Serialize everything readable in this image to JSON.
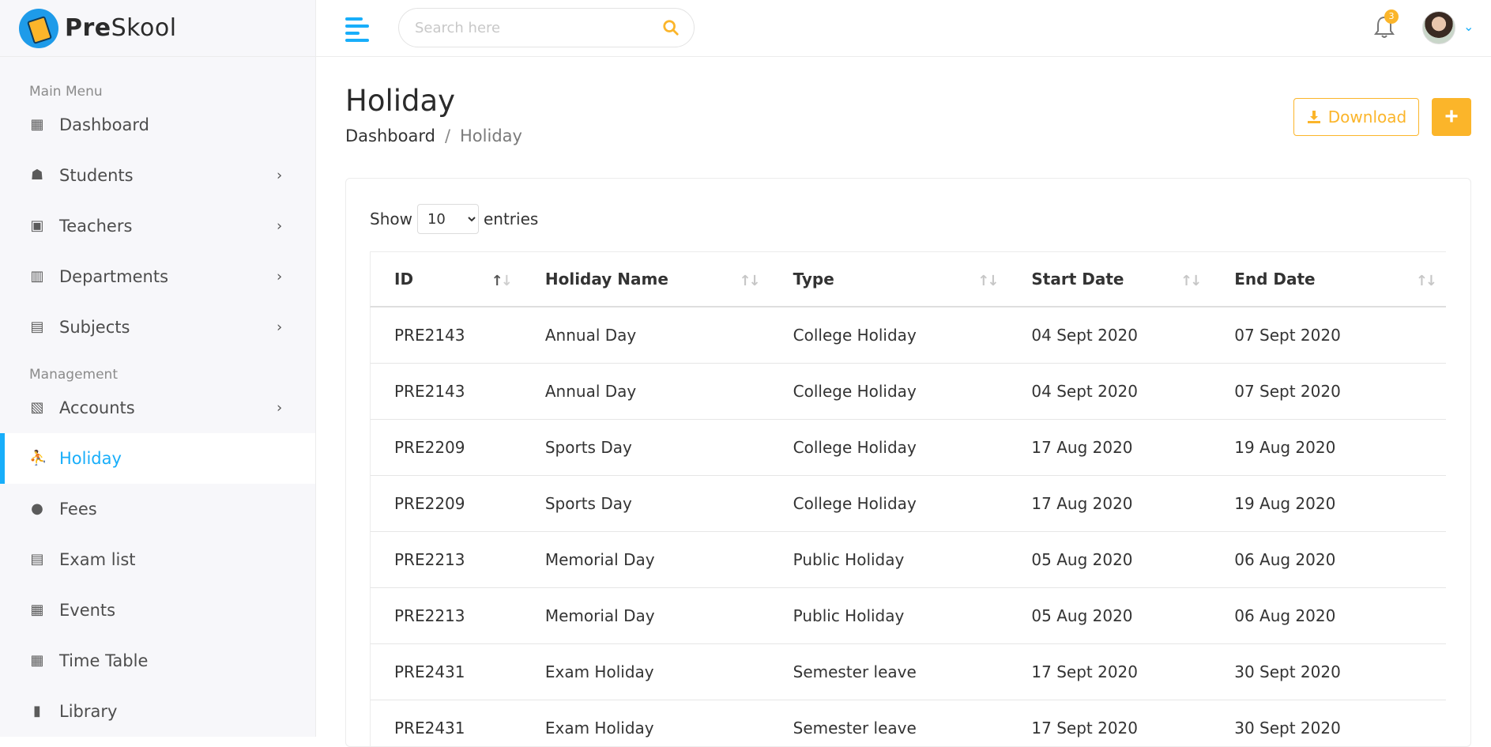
{
  "brand": {
    "name_bold": "Pre",
    "name_rest": "Skool"
  },
  "sidebar": {
    "section_main": "Main Menu",
    "section_management": "Management",
    "main_items": [
      {
        "label": "Dashboard",
        "icon": "dashboard-icon",
        "has_children": false
      },
      {
        "label": "Students",
        "icon": "student-icon",
        "has_children": true
      },
      {
        "label": "Teachers",
        "icon": "teacher-icon",
        "has_children": true
      },
      {
        "label": "Departments",
        "icon": "building-icon",
        "has_children": true
      },
      {
        "label": "Subjects",
        "icon": "book-reader-icon",
        "has_children": true
      }
    ],
    "management_items": [
      {
        "label": "Accounts",
        "icon": "invoice-icon",
        "has_children": true
      },
      {
        "label": "Holiday",
        "icon": "holiday-icon",
        "has_children": false,
        "active": true
      },
      {
        "label": "Fees",
        "icon": "fees-icon",
        "has_children": false
      },
      {
        "label": "Exam list",
        "icon": "clipboard-icon",
        "has_children": false
      },
      {
        "label": "Events",
        "icon": "calendar-icon",
        "has_children": false
      },
      {
        "label": "Time Table",
        "icon": "table-icon",
        "has_children": false
      },
      {
        "label": "Library",
        "icon": "library-icon",
        "has_children": false
      }
    ]
  },
  "header": {
    "search_placeholder": "Search here",
    "notification_count": "3"
  },
  "page": {
    "title": "Holiday",
    "breadcrumb_home": "Dashboard",
    "breadcrumb_sep": "/",
    "breadcrumb_current": "Holiday",
    "download_label": "Download",
    "add_label": "+"
  },
  "table": {
    "show_label": "Show",
    "entries_label": "entries",
    "page_size": "10",
    "columns": [
      "ID",
      "Holiday Name",
      "Type",
      "Start Date",
      "End Date"
    ],
    "rows": [
      [
        "PRE2143",
        "Annual Day",
        "College Holiday",
        "04 Sept 2020",
        "07 Sept 2020"
      ],
      [
        "PRE2143",
        "Annual Day",
        "College Holiday",
        "04 Sept 2020",
        "07 Sept 2020"
      ],
      [
        "PRE2209",
        "Sports Day",
        "College Holiday",
        "17 Aug 2020",
        "19 Aug 2020"
      ],
      [
        "PRE2209",
        "Sports Day",
        "College Holiday",
        "17 Aug 2020",
        "19 Aug 2020"
      ],
      [
        "PRE2213",
        "Memorial Day",
        "Public Holiday",
        "05 Aug 2020",
        "06 Aug 2020"
      ],
      [
        "PRE2213",
        "Memorial Day",
        "Public Holiday",
        "05 Aug 2020",
        "06 Aug 2020"
      ],
      [
        "PRE2431",
        "Exam Holiday",
        "Semester leave",
        "17 Sept 2020",
        "30 Sept 2020"
      ],
      [
        "PRE2431",
        "Exam Holiday",
        "Semester leave",
        "17 Sept 2020",
        "30 Sept 2020"
      ]
    ]
  },
  "colors": {
    "primary": "#18aefa",
    "accent": "#fbb52a"
  }
}
